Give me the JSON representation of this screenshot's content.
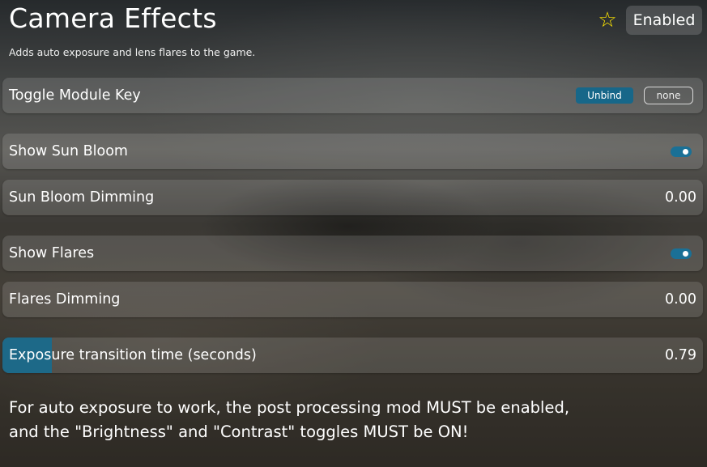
{
  "header": {
    "title": "Camera Effects",
    "subtitle": "Adds auto exposure and lens flares to the game.",
    "favorite_icon": "star-outline-icon",
    "favorite_icon_glyph": "☆",
    "enabled_label": "Enabled"
  },
  "settings": {
    "toggle_key": {
      "label": "Toggle Module Key",
      "unbind_label": "Unbind",
      "key_value": "none"
    },
    "show_sun_bloom": {
      "label": "Show Sun Bloom",
      "on": true
    },
    "sun_bloom_dimming": {
      "label": "Sun Bloom Dimming",
      "value": "0.00"
    },
    "show_flares": {
      "label": "Show Flares",
      "on": true
    },
    "flares_dimming": {
      "label": "Flares Dimming",
      "value": "0.00"
    },
    "exposure_time": {
      "label": "Exposure transition time (seconds)",
      "value": "0.79",
      "fill_fraction": 0.07
    }
  },
  "note": {
    "line1": "For auto exposure to work, the post processing mod MUST be enabled,",
    "line2": "and the \"Brightness\" and \"Contrast\" toggles MUST be ON!"
  },
  "colors": {
    "accent": "#176789",
    "favorite": "#ffe600"
  }
}
